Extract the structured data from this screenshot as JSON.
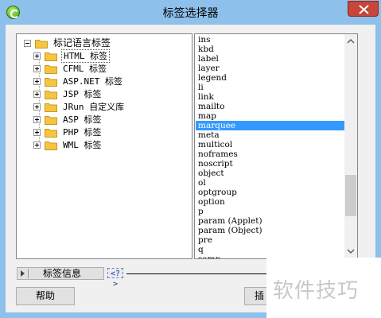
{
  "window": {
    "title": "标签选择器"
  },
  "tree": {
    "root": {
      "label": "标记语言标签"
    },
    "children": [
      {
        "label": "HTML 标签",
        "selected": true
      },
      {
        "label": "CFML 标签"
      },
      {
        "label": "ASP.NET 标签"
      },
      {
        "label": "JSP 标签"
      },
      {
        "label": "JRun 自定义库"
      },
      {
        "label": "ASP 标签"
      },
      {
        "label": "PHP 标签"
      },
      {
        "label": "WML 标签"
      }
    ]
  },
  "tag_list": {
    "items": [
      "ins",
      "kbd",
      "label",
      "layer",
      "legend",
      "li",
      "link",
      "mailto",
      "map",
      "marquee",
      "meta",
      "multicol",
      "noframes",
      "noscript",
      "object",
      "ol",
      "optgroup",
      "option",
      "p",
      "param (Applet)",
      "param (Object)",
      "pre",
      "q",
      "samp"
    ],
    "selected": "marquee"
  },
  "tag_info": {
    "label": "标签信息",
    "help_chip": "<?>"
  },
  "buttons": {
    "help": "帮助",
    "insert": "插"
  },
  "watermark": "软件技巧",
  "colors": {
    "titlebar": "#8dc0ea",
    "selection": "#3399ff",
    "close": "#c7453a",
    "folder": "#f5c542"
  },
  "icons": {
    "app": "dreamweaver-app-icon",
    "close": "close-icon",
    "folder": "folder-icon"
  }
}
